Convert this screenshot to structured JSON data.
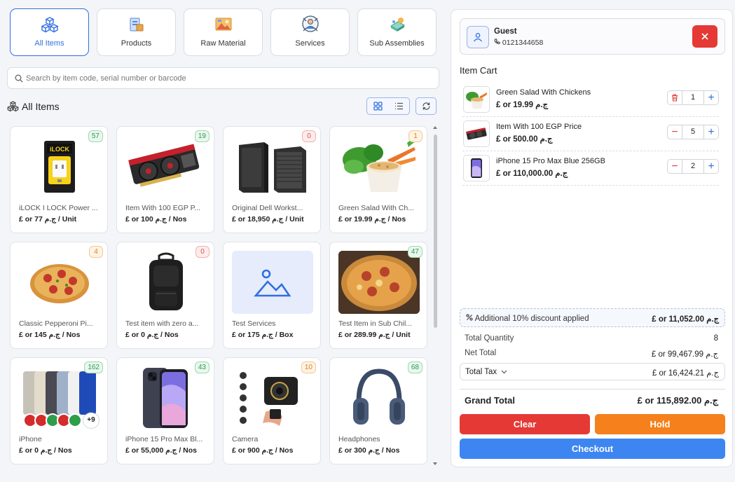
{
  "categories": [
    {
      "label": "All Items",
      "icon": "cubes-icon",
      "active": true
    },
    {
      "label": "Products",
      "icon": "products-icon"
    },
    {
      "label": "Raw Material",
      "icon": "raw-material-icon"
    },
    {
      "label": "Services",
      "icon": "services-icon"
    },
    {
      "label": "Sub Assemblies",
      "icon": "sub-assemblies-icon"
    }
  ],
  "search": {
    "placeholder": "Search by item code, serial number or barcode",
    "value": ""
  },
  "section": {
    "title": "All Items"
  },
  "items": [
    {
      "name": "iLOCK I LOCK Power ...",
      "price": "£ or 77 ج.م / Unit",
      "stock": "57",
      "badge": "green",
      "image": "charger-image"
    },
    {
      "name": "Item With 100 EGP P...",
      "price": "£ or 100 ج.م / Nos",
      "stock": "19",
      "badge": "green",
      "image": "graphics-card-image"
    },
    {
      "name": "Original Dell Workst...",
      "price": "£ or 18,950 ج.م / Unit",
      "stock": "0",
      "badge": "red",
      "image": "workstation-image"
    },
    {
      "name": "Green Salad With Ch...",
      "price": "£ or 19.99 ج.م / Nos",
      "stock": "1",
      "badge": "orange",
      "image": "salad-image"
    },
    {
      "name": "Classic Pepperoni Pi...",
      "price": "£ or 145 ج.م / Nos",
      "stock": "4",
      "badge": "orange",
      "image": "pizza-image"
    },
    {
      "name": "Test item with zero a...",
      "price": "£ or 0 ج.م / Nos",
      "stock": "0",
      "badge": "red",
      "image": "backpack-image"
    },
    {
      "name": "Test Services",
      "price": "£ or 175 ج.م / Box",
      "stock": "",
      "badge": "",
      "image": "placeholder-image"
    },
    {
      "name": "Test Item in Sub Chil...",
      "price": "£ or 289.99 ج.م / Unit",
      "stock": "47",
      "badge": "green",
      "image": "pizza-photo-image"
    },
    {
      "name": "iPhone",
      "price": "£ or 0 ج.م / Nos",
      "stock": "162",
      "badge": "green",
      "image": "iphones-image",
      "overlay": "+9"
    },
    {
      "name": "iPhone 15 Pro Max Bl...",
      "price": "£ or 55,000 ج.م / Nos",
      "stock": "43",
      "badge": "green",
      "image": "iphone-blue-image"
    },
    {
      "name": "Camera",
      "price": "£ or 900 ج.م / Nos",
      "stock": "10",
      "badge": "orange",
      "image": "mini-camera-image"
    },
    {
      "name": "Headphones",
      "price": "£ or 300 ج.م / Nos",
      "stock": "68",
      "badge": "green",
      "image": "headphones-image"
    }
  ],
  "customer": {
    "name": "Guest",
    "phone": "0121344658"
  },
  "cart": {
    "title": "Item Cart",
    "rows": [
      {
        "name": "Green Salad With Chickens",
        "price": "£ or 19.99 ج.م",
        "qty": "1",
        "left_action": "delete"
      },
      {
        "name": "Item With 100 EGP Price",
        "price": "£ or 500.00 ج.م",
        "qty": "5",
        "left_action": "minus"
      },
      {
        "name": "iPhone 15 Pro Max Blue 256GB",
        "price": "£ or 110,000.00 ج.م",
        "qty": "2",
        "left_action": "minus"
      }
    ]
  },
  "discount": {
    "label": "Additional 10% discount applied",
    "value": "£ or 11,052.00 ج.م"
  },
  "totals": {
    "quantity_label": "Total Quantity",
    "quantity": "8",
    "net_label": "Net Total",
    "net": "£ or 99,467.99 ج.م",
    "tax_label": "Total Tax",
    "tax": "£ or 16,424.21 ج.م",
    "grand_label": "Grand Total",
    "grand": "£ or 115,892.00 ج.م"
  },
  "buttons": {
    "clear": "Clear",
    "hold": "Hold",
    "checkout": "Checkout"
  },
  "colors": {
    "accent": "#2f6fe0",
    "clear": "#e53935",
    "hold": "#f5801c",
    "checkout": "#3d86f2",
    "close": "#e53935"
  }
}
